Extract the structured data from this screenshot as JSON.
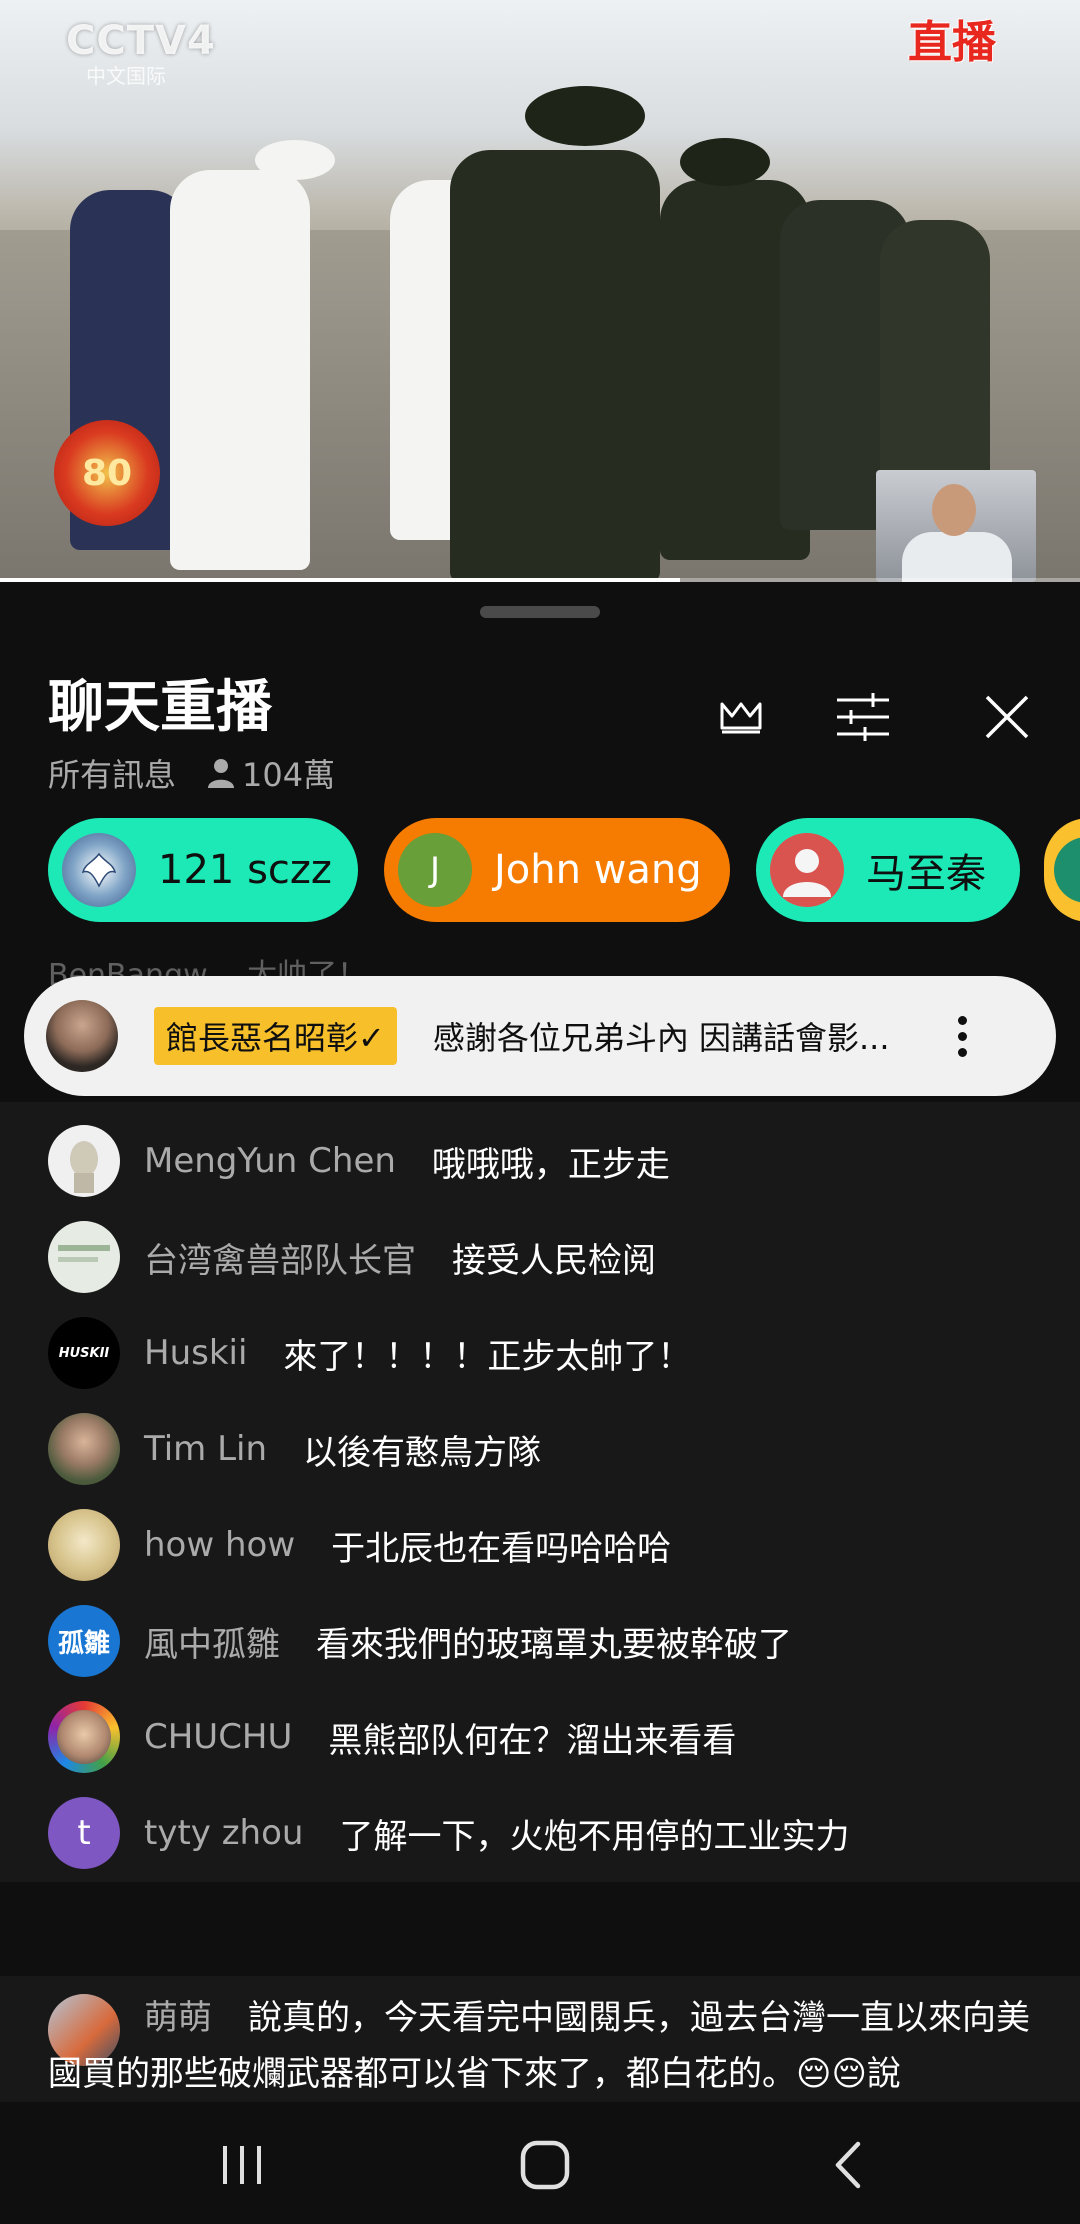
{
  "video": {
    "channel_logo": "CCTV4",
    "channel_sub": "中文国际",
    "live_label": "直播",
    "anniversary_badge": "80",
    "progress": 0.63
  },
  "chat_panel": {
    "title": "聊天重播",
    "filter_label": "所有訊息",
    "viewer_count": "104萬",
    "icons": {
      "crown": "crown-icon",
      "settings": "sliders-icon",
      "close": "close-icon"
    }
  },
  "super_chat_pills": [
    {
      "name": "121 sczz",
      "avatar": "",
      "color": "#1de9b6",
      "text_color": "#0f0f0f"
    },
    {
      "name": "John wang",
      "avatar": "J",
      "color": "#f57c00",
      "text_color": "#ffffff"
    },
    {
      "name": "马至秦",
      "avatar": "",
      "color": "#1de9b6",
      "text_color": "#0f0f0f"
    }
  ],
  "faded_message": {
    "author": "BenBangw",
    "text": "太帅了！"
  },
  "pinned": {
    "author_tag": "館長惡名昭彰✓",
    "message": "感謝各位兄弟斗內 因講話會影..."
  },
  "messages": [
    {
      "author": "MengYun Chen",
      "text": "哦哦哦，正步走",
      "avatar_text": "",
      "avatar_color": "#e8e8e8"
    },
    {
      "author": "台湾禽兽部队长官",
      "text": "接受人民检阅",
      "avatar_text": "",
      "avatar_color": "#dfe6dc"
    },
    {
      "author": "Huskii",
      "text": "來了！！！！正步太帥了！",
      "avatar_text": "HUSKII",
      "avatar_color": "#000000"
    },
    {
      "author": "Tim Lin",
      "text": "以後有憨鳥方隊",
      "avatar_text": "",
      "avatar_color": "#6f7a63"
    },
    {
      "author": "how how",
      "text": "于北辰也在看吗哈哈哈",
      "avatar_text": "",
      "avatar_color": "#d9cfa4"
    },
    {
      "author": "風中孤雛",
      "text": "看來我們的玻璃罩丸要被幹破了",
      "avatar_text": "孤雛",
      "avatar_color": "#1976d2"
    },
    {
      "author": "CHUCHU",
      "text": "黑熊部队何在？溜出来看看",
      "avatar_text": "",
      "avatar_color": "#e53935"
    },
    {
      "author": "tyty zhou",
      "text": "了解一下，火炮不用停的工业实力",
      "avatar_text": "t",
      "avatar_color": "#7e57c2"
    }
  ],
  "bottom_message": {
    "author": "萌萌",
    "text": "說真的，今天看完中國閱兵，過去台灣一直以來向美國買的那些破爛武器都可以省下來了，都白花的。😔😔說"
  },
  "nav": {
    "recents": "recents-icon",
    "home": "home-icon",
    "back": "back-icon"
  }
}
